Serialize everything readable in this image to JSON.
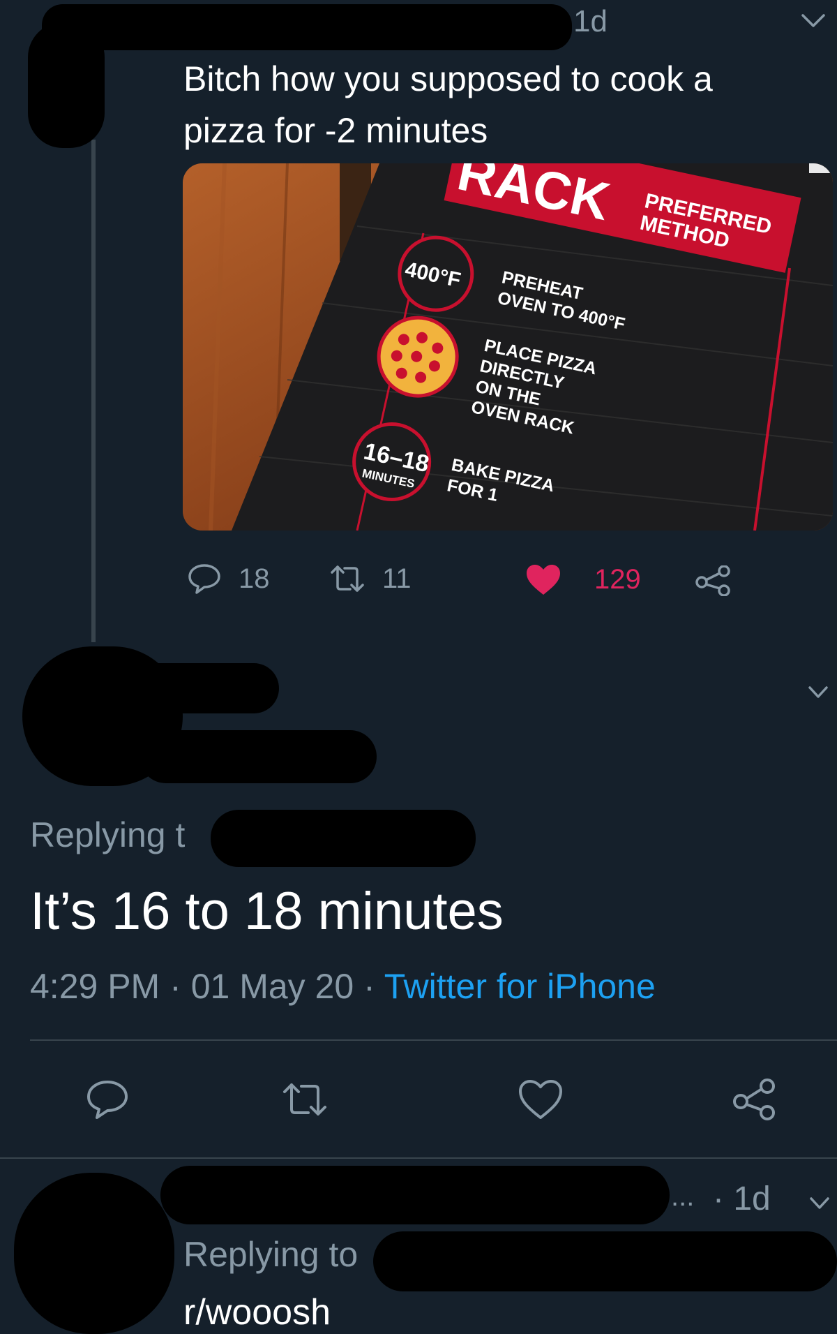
{
  "tweet1": {
    "time_ago": "1d",
    "text_line1": "Bitch how you supposed to cook a",
    "text_line2": "pizza for -2 minutes",
    "media": {
      "rack_label": "RACK",
      "preferred_line1": "PREFERRED",
      "preferred_line2": "METHOD",
      "temp_badge": "400°F",
      "step1_line1": "PREHEAT",
      "step1_line2": "OVEN TO 400°F",
      "step2_line1": "PLACE PIZZA",
      "step2_line2": "DIRECTLY",
      "step2_line3": "ON THE",
      "step2_line4": "OVEN RACK",
      "minutes_badge": "16–18",
      "minutes_label": "MINUTES",
      "step3_line1": "BAKE PIZZA",
      "step3_line2": "FOR 1"
    },
    "actions": {
      "replies": "18",
      "retweets": "11",
      "likes": "129"
    }
  },
  "tweet2": {
    "replying_prefix": "Replying t",
    "text": "It’s 16 to 18 minutes",
    "time": "4:29 PM",
    "date": "01 May 20",
    "separator": "·",
    "source": "Twitter for iPhone"
  },
  "tweet3": {
    "ellipsis": "...",
    "time_ago": "· 1d",
    "replying_label": "Replying to",
    "replying_target": "r/wooosh"
  },
  "colors": {
    "background": "#15202b",
    "muted": "#8899a6",
    "link": "#1da1f2",
    "like": "#e0245e",
    "thread_line": "#38444d"
  }
}
